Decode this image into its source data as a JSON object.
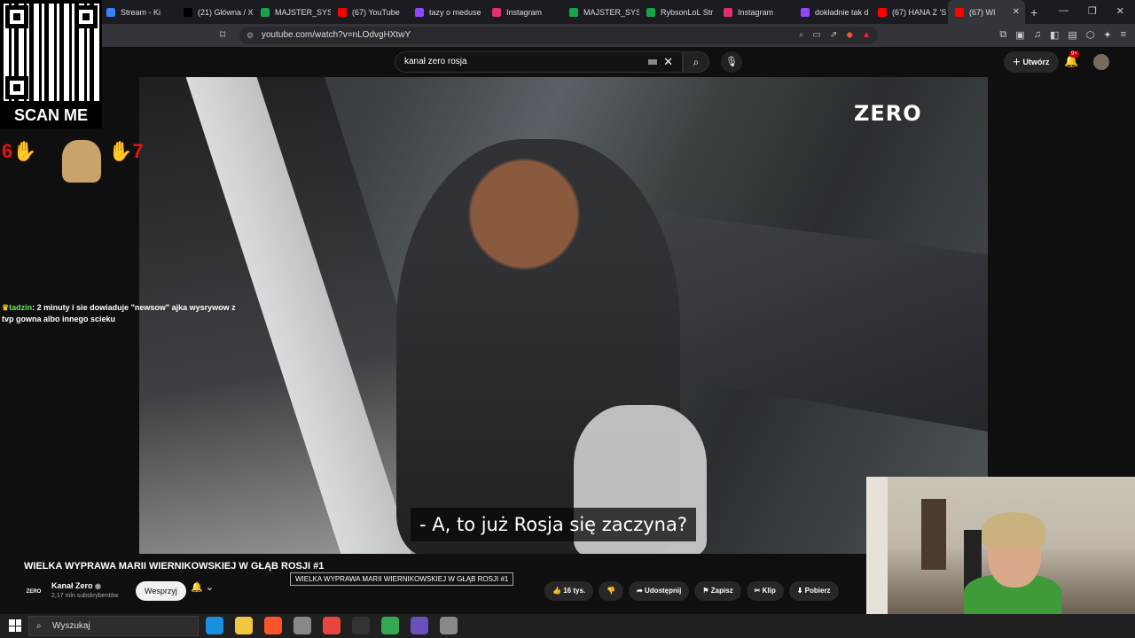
{
  "browser": {
    "tabs": [
      {
        "label": "Stream - Ki",
        "color": "#3b82f6"
      },
      {
        "label": "(21) Główna / X",
        "color": "#000000"
      },
      {
        "label": "MAJSTER_SYS",
        "color": "#16a34a"
      },
      {
        "label": "(67) YouTube",
        "color": "#ff0000"
      },
      {
        "label": "tazy o meduse",
        "color": "#9146ff"
      },
      {
        "label": "Instagram",
        "color": "#e1306c"
      },
      {
        "label": "MAJSTER_SYS",
        "color": "#16a34a"
      },
      {
        "label": "RybsonLoL Str",
        "color": "#16a34a"
      },
      {
        "label": "Instagram",
        "color": "#e1306c"
      },
      {
        "label": "dokładnie tak d",
        "color": "#9146ff"
      },
      {
        "label": "(67) HANA Z 'S",
        "color": "#ff0000"
      },
      {
        "label": "(67) WI",
        "color": "#ff0000",
        "active": true
      }
    ],
    "url": "youtube.com/watch?v=nLOdvgHXtwY"
  },
  "youtube": {
    "search_value": "kanał zero rosja",
    "create_label": "Utwórz",
    "notif_badge": "9+"
  },
  "video": {
    "watermark": "ZERO",
    "subtitle": "- A, to już Rosja się zaczyna?"
  },
  "overlay": {
    "qr_label": "SCAN ME",
    "chat_user": "tadzin",
    "chat_text": ": 2 minuty i sie dowiaduje \"newsow\" ajka wysrywow z tvp gowna albo innego scieku"
  },
  "info": {
    "title": "WIELKA WYPRAWA MARII WIERNIKOWSKIEJ W GŁĄB ROSJI #1",
    "tooltip": "WIELKA WYPRAWA MARII WIERNIKOWSKIEJ W GŁĄB ROSJI #1",
    "channel_name": "Kanał Zero",
    "channel_logo": "ZERO",
    "subscribers": "2,17 mln subskrybentów",
    "support_label": "Wesprzyj",
    "likes": "16 tys.",
    "share": "Udostępnij",
    "save": "Zapisz",
    "clip": "Klip",
    "download": "Pobierz"
  },
  "taskbar": {
    "search_placeholder": "Wyszukaj",
    "apps": [
      {
        "name": "edge-app-icon",
        "color": "#1a8fe0"
      },
      {
        "name": "file-explorer-icon",
        "color": "#f2c744"
      },
      {
        "name": "brave-app-icon",
        "color": "#fb542b"
      },
      {
        "name": "app-icon-4",
        "color": "#888888"
      },
      {
        "name": "chrome-app-icon",
        "color": "#e8453c"
      },
      {
        "name": "app-icon-6",
        "color": "#333333"
      },
      {
        "name": "app-icon-7",
        "color": "#34a853"
      },
      {
        "name": "app-icon-8",
        "color": "#6b4fbb"
      },
      {
        "name": "app-icon-9",
        "color": "#888888"
      }
    ]
  }
}
